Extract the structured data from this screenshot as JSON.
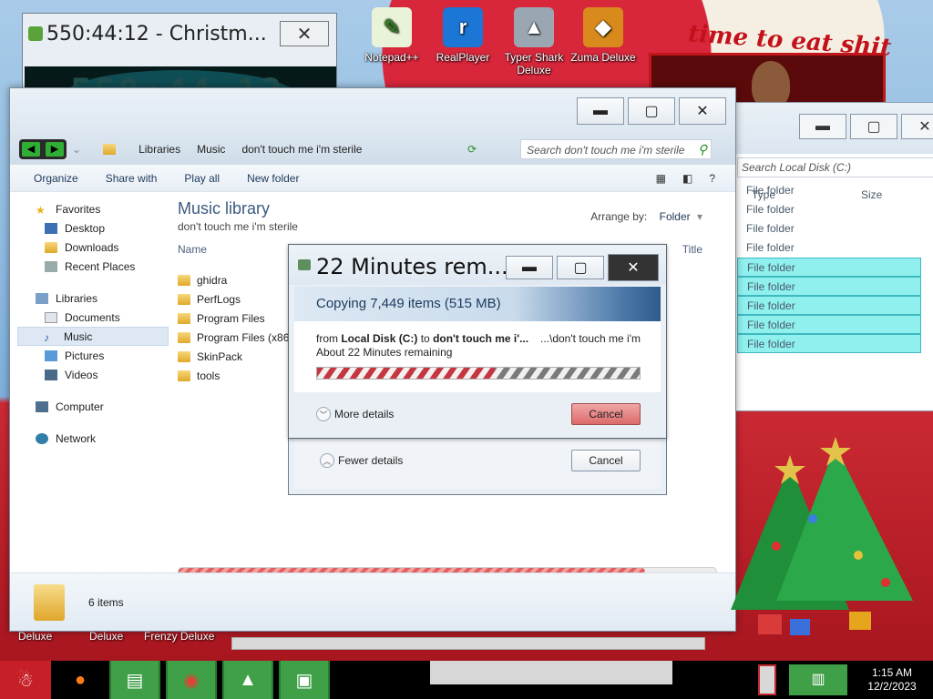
{
  "desktop": {
    "icons": [
      {
        "label": "Notepad++"
      },
      {
        "label": "RealPlayer"
      },
      {
        "label": "Typer Shark Deluxe"
      },
      {
        "label": "Zuma Deluxe"
      }
    ],
    "banner_text": "time to eat shit",
    "bottom_labels": [
      "Deluxe",
      "Deluxe",
      "Frenzy Deluxe"
    ]
  },
  "timer_window": {
    "title": "550:44:12 - Christm...",
    "display": "550:44:12",
    "close_glyph": "✕"
  },
  "background_explorer": {
    "search_placeholder": "Search Local Disk (C:)",
    "columns": [
      "Type",
      "Size"
    ],
    "rows": [
      {
        "type": "File folder",
        "selected": false
      },
      {
        "type": "File folder",
        "selected": false
      },
      {
        "type": "File folder",
        "selected": false
      },
      {
        "type": "File folder",
        "selected": false
      },
      {
        "type": "File folder",
        "selected": true
      },
      {
        "type": "File folder",
        "selected": true
      },
      {
        "type": "File folder",
        "selected": true
      },
      {
        "type": "File folder",
        "selected": true
      },
      {
        "type": "File folder",
        "selected": true
      }
    ]
  },
  "explorer": {
    "breadcrumb": [
      "Libraries",
      "Music",
      "don't touch me i'm sterile"
    ],
    "search_placeholder": "Search don't touch me i'm sterile",
    "commands": [
      "Organize",
      "Share with",
      "Play all",
      "New folder"
    ],
    "nav": {
      "favorites_header": "Favorites",
      "favorites": [
        "Desktop",
        "Downloads",
        "Recent Places"
      ],
      "libraries_header": "Libraries",
      "libraries": [
        "Documents",
        "Music",
        "Pictures",
        "Videos"
      ],
      "selected": "Music",
      "computer": "Computer",
      "network": "Network"
    },
    "library_title": "Music library",
    "library_subtitle": "don't touch me i'm sterile",
    "arrange_label": "Arrange by:",
    "arrange_value": "Folder",
    "columns": {
      "name": "Name",
      "title": "Title"
    },
    "files": [
      "ghidra",
      "PerfLogs",
      "Program Files",
      "Program Files (x86)",
      "SkinPack",
      "tools"
    ],
    "status": "6 items"
  },
  "copy_dialog": {
    "title": "22 Minutes rem...",
    "header": "Copying 7,449 items (515 MB)",
    "from_prefix": "from",
    "source": "Local Disk (C:)",
    "to_word": "to",
    "destination": "don't touch me i'...",
    "dest_path": "...\\don't touch me i'm",
    "remaining": "About 22 Minutes remaining",
    "progress_percent": 55,
    "more_details": "More details",
    "fewer_details": "Fewer details",
    "cancel_label": "Cancel"
  },
  "taskbar": {
    "time": "1:15 AM",
    "date": "12/2/2023"
  }
}
